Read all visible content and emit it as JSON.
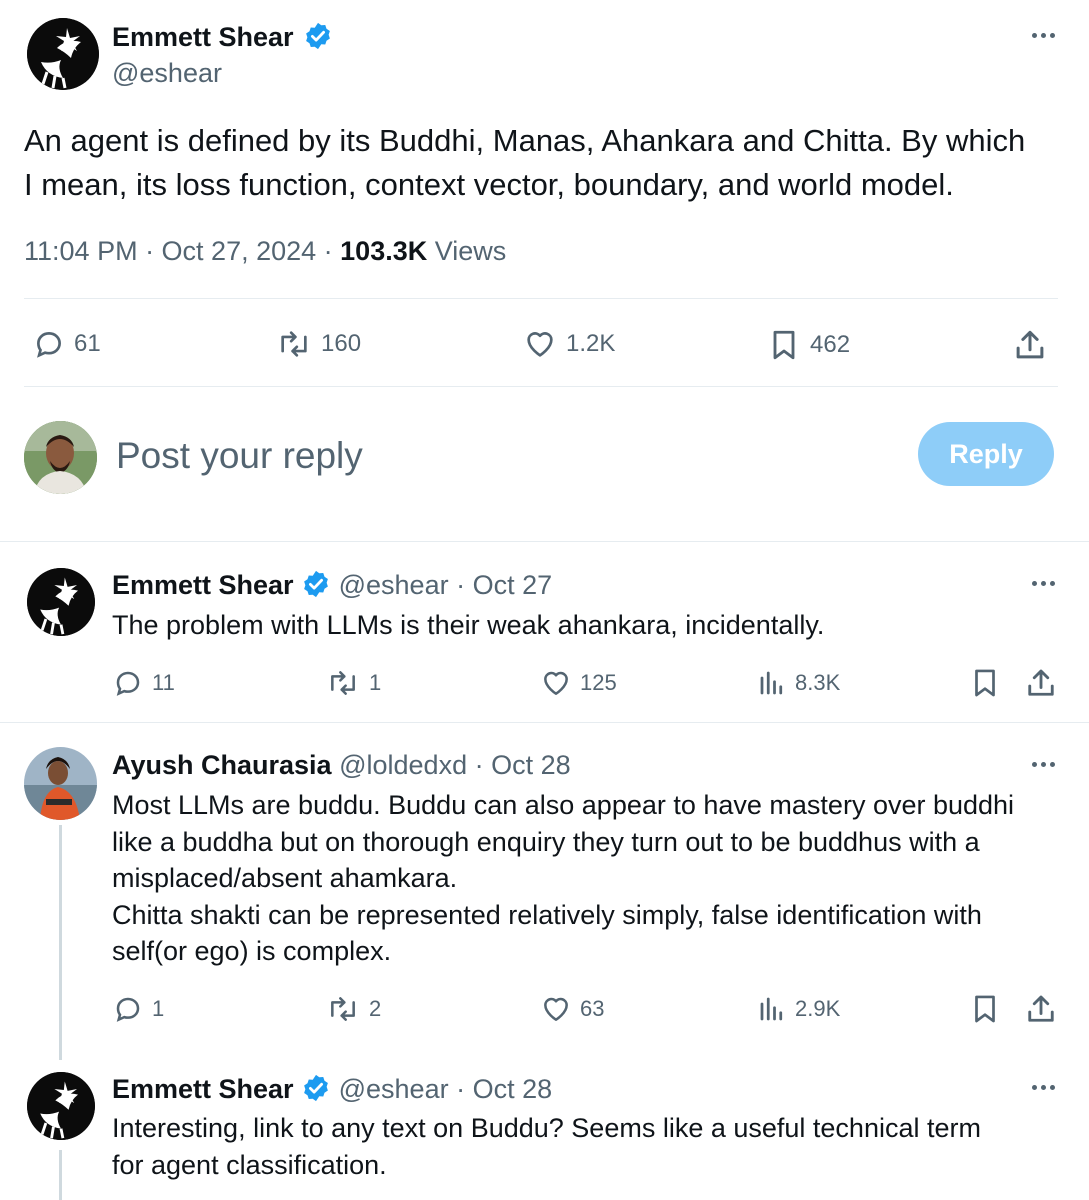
{
  "main_tweet": {
    "author_name": "Emmett Shear",
    "author_handle": "@eshear",
    "text_line1": "An agent is defined by its Buddhi, Manas, Ahankara and Chitta. By which",
    "text_line2": "I mean, its loss function, context vector, boundary, and world model.",
    "timestamp": "11:04 PM · Oct 27, 2024 · ",
    "views_count": "103.3K",
    "views_label": " Views",
    "replies": "61",
    "reposts": "160",
    "likes": "1.2K",
    "bookmarks": "462"
  },
  "reply_box": {
    "placeholder": "Post your reply",
    "button_label": "Reply"
  },
  "replies": [
    {
      "author_name": "Emmett Shear",
      "meta": "@eshear · Oct 27",
      "lines": [
        "The problem with LLMs is their weak ahankara, incidentally."
      ],
      "replies": "11",
      "reposts": "1",
      "likes": "125",
      "views": "8.3K"
    },
    {
      "author_name": "Ayush Chaurasia",
      "meta": "@loldedxd · Oct 28",
      "lines": [
        "Most LLMs are buddu. Buddu can also appear to have mastery over buddhi",
        "like a buddha but on thorough enquiry they turn out to be buddhus with a",
        "misplaced/absent ahamkara.",
        "Chitta shakti can be represented relatively simply, false identification with",
        "self(or ego) is complex."
      ],
      "replies": "1",
      "reposts": "2",
      "likes": "63",
      "views": "2.9K"
    },
    {
      "author_name": "Emmett Shear",
      "meta": "@eshear · Oct 28",
      "lines": [
        "Interesting, link to any text on Buddu? Seems like a useful technical term",
        "for agent classification."
      ]
    }
  ],
  "colors": {
    "verified": "#1d9bf0",
    "reply_button_disabled": "#8ecdf8",
    "muted_text": "#536471",
    "divider": "#e6ecf0"
  }
}
